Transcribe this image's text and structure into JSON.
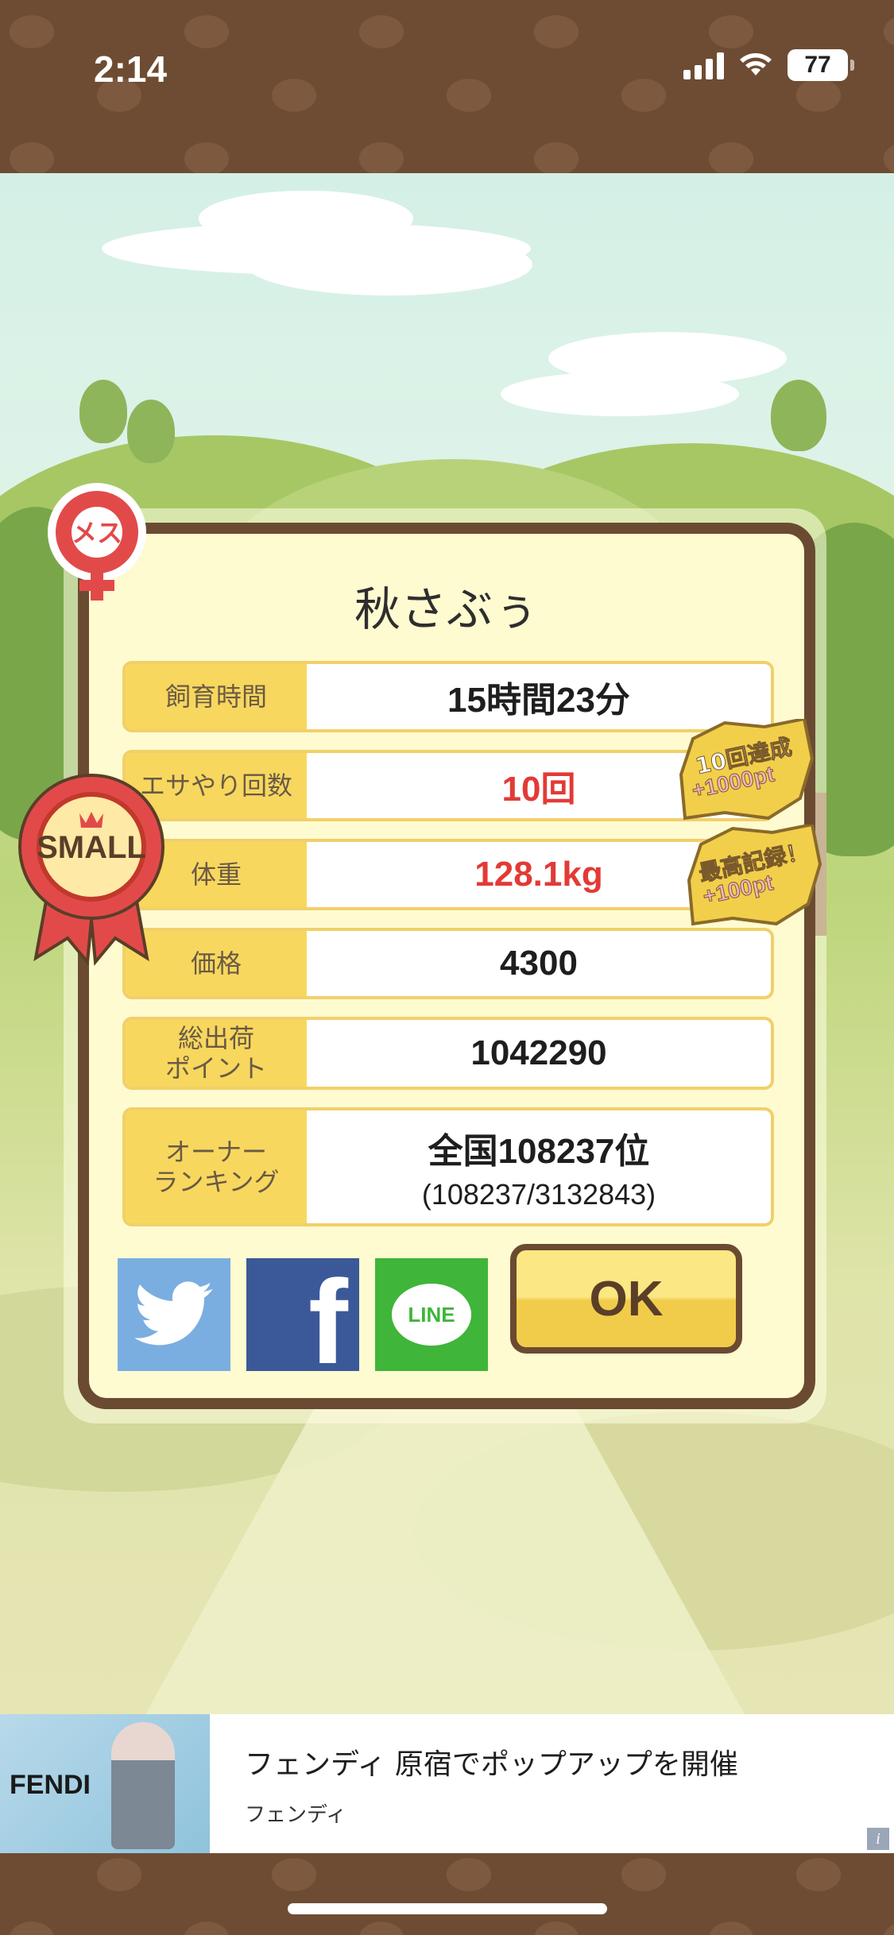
{
  "status_bar": {
    "time": "2:14",
    "battery": "77"
  },
  "dialog": {
    "pet_name": "秋さぶぅ",
    "gender_badge": "メス",
    "size_badge": "SMALL",
    "stats": [
      {
        "label": "飼育時間",
        "value": "15時間23分",
        "highlight": false
      },
      {
        "label": "エサやり回数",
        "value": "10回",
        "highlight": true
      },
      {
        "label": "体重",
        "value": "128.1kg",
        "highlight": true
      },
      {
        "label": "価格",
        "value": "4300",
        "highlight": false
      },
      {
        "label": "総出荷\nポイント",
        "value": "1042290",
        "highlight": false
      },
      {
        "label": "オーナー\nランキング",
        "value": "全国108237位",
        "sub": "(108237/3132843)",
        "highlight": false
      }
    ],
    "bonus_badges": [
      {
        "line1": "10回達成",
        "line2": "+1000pt"
      },
      {
        "line1": "最高記録！",
        "line2": "+100pt"
      }
    ],
    "share": {
      "twitter": "twitter-icon",
      "facebook": "f",
      "line": "LINE"
    },
    "ok_label": "OK"
  },
  "ad": {
    "image_brand": "FENDI",
    "title": "フェンディ 原宿でポップアップを開催",
    "advertiser": "フェンディ",
    "info": "i"
  },
  "colors": {
    "frame_brown": "#6b4a32",
    "dialog_bg": "#fffbd0",
    "label_yellow": "#f7d75e",
    "highlight_red": "#e23a36",
    "twitter_blue": "#7aaee0",
    "facebook_blue": "#3b5998",
    "line_green": "#3fb53a"
  }
}
